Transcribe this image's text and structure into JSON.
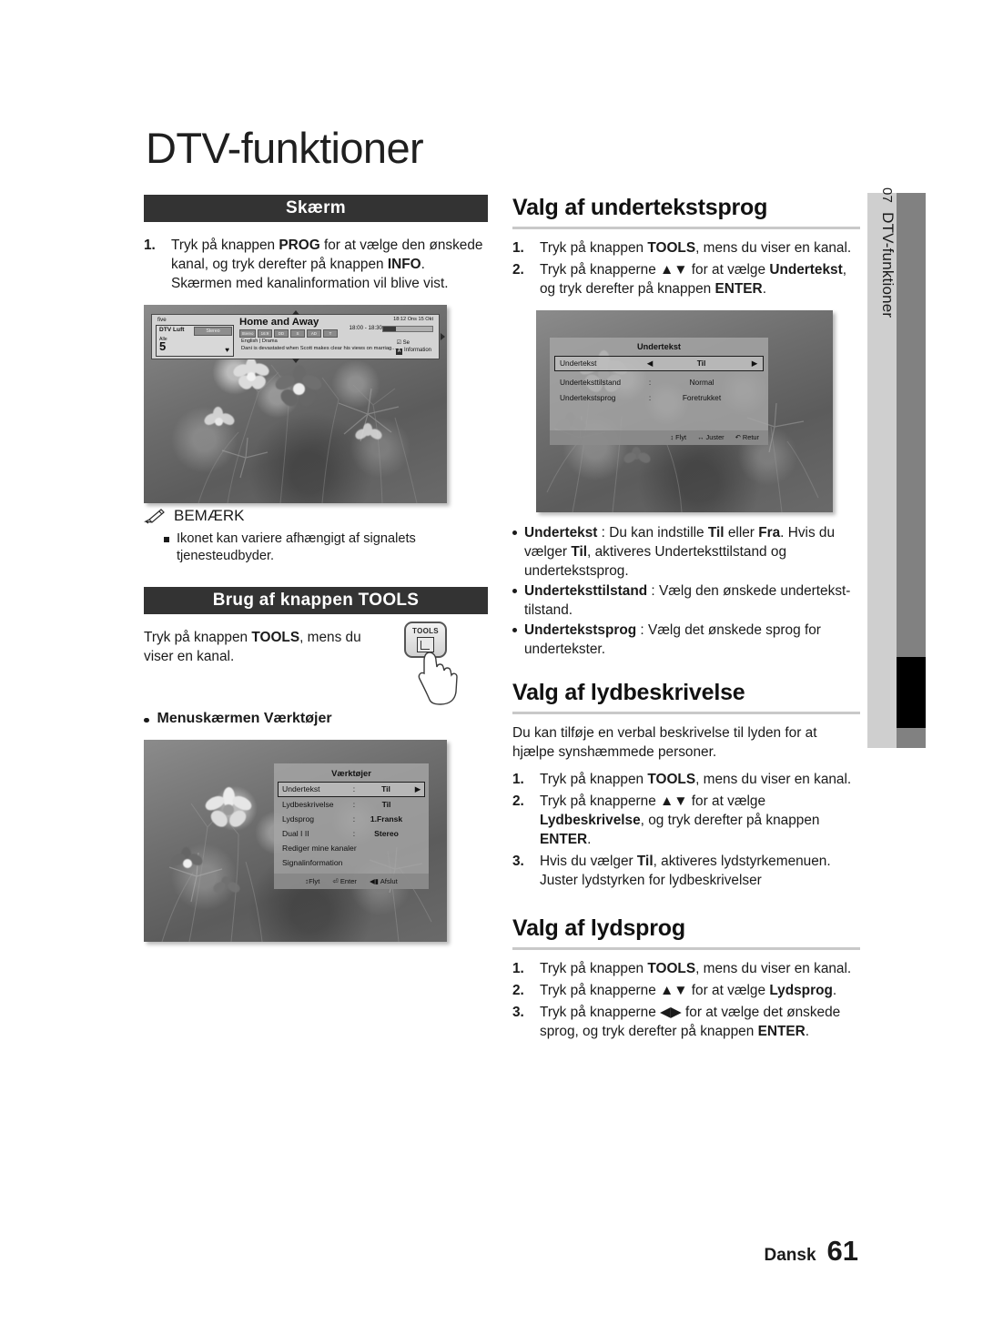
{
  "document": {
    "title": "DTV-funktioner",
    "footer": {
      "language": "Dansk",
      "page_number": "61"
    }
  },
  "sidebar": {
    "chapter_number": "07",
    "chapter_label": "DTV-funktioner"
  },
  "left_column": {
    "banner_skaerm": "Skærm",
    "steps": [
      {
        "num": "1.",
        "prefix": "Tryk på knappen ",
        "bold1": "PROG",
        "mid": " for at vælge den ønskede kanal, og tryk derefter på knappen ",
        "bold2": "INFO",
        "suffix": ". Skærmen med kanalinformation vil blive vist."
      }
    ],
    "note": {
      "heading": "BEMÆRK",
      "items": [
        "Ikonet kan variere afhængigt af signalets tjenesteudbyder."
      ]
    },
    "banner_tools": "Brug af knappen TOOLS",
    "tools_text": {
      "prefix": "Tryk på knappen ",
      "bold": "TOOLS",
      "suffix": ", mens du viser en kanal."
    },
    "tools_key_label": "TOOLS",
    "menu_bullet": "Menuskærmen Værktøjer"
  },
  "screen_info_banner": {
    "channel_brand": "five",
    "source": "DTV Luft",
    "audio": "Stereo",
    "list_label": "Alle",
    "channel_number": "5",
    "program_title": "Home and Away",
    "chips": [
      "Stereo",
      "16:9",
      "DD",
      "S",
      "AD",
      "T"
    ],
    "genre": "English  |  Drama",
    "description": "Dani is devastated when Scott makes clear his views on marriag...",
    "clock": "18:12 Ons 15 Okt",
    "timespan": "18:00 - 18:30",
    "action_watch": "Se",
    "action_info": "Information",
    "info_key": "A",
    "progress_percent": 26
  },
  "screen_vaerktojer": {
    "title": "Værktøjer",
    "rows": [
      {
        "label": "Undertekst",
        "sep": ":",
        "value": "Til",
        "selected": true,
        "arrow": true
      },
      {
        "label": "Lydbeskrivelse",
        "sep": ":",
        "value": "Til",
        "selected": false,
        "arrow": false
      },
      {
        "label": "Lydsprog",
        "sep": ":",
        "value": "1.Fransk",
        "selected": false,
        "arrow": false
      },
      {
        "label": "Dual I II",
        "sep": ":",
        "value": "Stereo",
        "selected": false,
        "arrow": false
      },
      {
        "label": "Rediger mine kanaler",
        "sep": "",
        "value": "",
        "selected": false,
        "arrow": false
      },
      {
        "label": "Signalinformation",
        "sep": "",
        "value": "",
        "selected": false,
        "arrow": false
      }
    ],
    "footer": [
      {
        "icon": "updown-arrows-icon",
        "label": "Flyt"
      },
      {
        "icon": "enter-icon",
        "label": "Enter"
      },
      {
        "icon": "exit-icon",
        "label": "Afslut"
      }
    ]
  },
  "screen_undertekst": {
    "title": "Undertekst",
    "rows": [
      {
        "label": "Undertekst",
        "sep": "",
        "value": "Til",
        "selected": true,
        "arrows": true
      },
      {
        "label": "Underteksttilstand",
        "sep": ":",
        "value": "Normal",
        "selected": false,
        "arrows": false
      },
      {
        "label": "Undertekstsprog",
        "sep": ":",
        "value": "Foretrukket",
        "selected": false,
        "arrows": false
      }
    ],
    "footer": [
      {
        "icon": "updown-arrows-icon",
        "label": "Flyt"
      },
      {
        "icon": "leftright-arrows-icon",
        "label": "Juster"
      },
      {
        "icon": "return-icon",
        "label": "Retur"
      }
    ]
  },
  "right_column": {
    "sections": [
      {
        "heading": "Valg af undertekstsprog",
        "steps": [
          {
            "num": "1.",
            "parts": [
              {
                "t": "Tryk på knappen ",
                "b": false
              },
              {
                "t": "TOOLS",
                "b": true
              },
              {
                "t": ", mens du viser en kanal.",
                "b": false
              }
            ]
          },
          {
            "num": "2.",
            "parts": [
              {
                "t": "Tryk på knapperne ▲▼ for at vælge ",
                "b": false
              },
              {
                "t": "Undertekst",
                "b": true
              },
              {
                "t": ", og tryk derefter på knappen ",
                "b": false
              },
              {
                "t": "ENTER",
                "b": true
              },
              {
                "t": ".",
                "b": false
              }
            ]
          }
        ],
        "bullets": [
          {
            "parts": [
              {
                "t": "Undertekst",
                "b": true
              },
              {
                "t": " : Du kan indstille ",
                "b": false
              },
              {
                "t": "Til",
                "b": true
              },
              {
                "t": " eller ",
                "b": false
              },
              {
                "t": "Fra",
                "b": true
              },
              {
                "t": ". Hvis du vælger ",
                "b": false
              },
              {
                "t": "Til",
                "b": true
              },
              {
                "t": ", aktiveres Underteksttilstand og undertekstsprog.",
                "b": false
              }
            ]
          },
          {
            "parts": [
              {
                "t": "Underteksttilstand",
                "b": true
              },
              {
                "t": " : Vælg den ønskede undertekst-tilstand.",
                "b": false
              }
            ]
          },
          {
            "parts": [
              {
                "t": "Undertekstsprog",
                "b": true
              },
              {
                "t": " : Vælg det ønskede sprog for undertekster.",
                "b": false
              }
            ]
          }
        ]
      },
      {
        "heading": "Valg af lydbeskrivelse",
        "intro": "Du kan tilføje en verbal beskrivelse til lyden for at hjælpe synshæmmede personer.",
        "steps": [
          {
            "num": "1.",
            "parts": [
              {
                "t": "Tryk på knappen ",
                "b": false
              },
              {
                "t": "TOOLS",
                "b": true
              },
              {
                "t": ", mens du viser en kanal.",
                "b": false
              }
            ]
          },
          {
            "num": "2.",
            "parts": [
              {
                "t": "Tryk på knapperne ▲▼ for at vælge ",
                "b": false
              },
              {
                "t": "Lydbeskrivelse",
                "b": true
              },
              {
                "t": ", og tryk derefter på knappen ",
                "b": false
              },
              {
                "t": "ENTER",
                "b": true
              },
              {
                "t": ".",
                "b": false
              }
            ]
          },
          {
            "num": "3.",
            "parts": [
              {
                "t": "Hvis du vælger ",
                "b": false
              },
              {
                "t": "Til",
                "b": true
              },
              {
                "t": ", aktiveres lydstyrkemenuen. Juster lydstyrken for lydbeskrivelser",
                "b": false
              }
            ]
          }
        ]
      },
      {
        "heading": "Valg af lydsprog",
        "steps": [
          {
            "num": "1.",
            "parts": [
              {
                "t": "Tryk på knappen ",
                "b": false
              },
              {
                "t": "TOOLS",
                "b": true
              },
              {
                "t": ", mens du viser en kanal.",
                "b": false
              }
            ]
          },
          {
            "num": "2.",
            "parts": [
              {
                "t": "Tryk på knapperne ▲▼ for at vælge ",
                "b": false
              },
              {
                "t": "Lydsprog",
                "b": true
              },
              {
                "t": ".",
                "b": false
              }
            ]
          },
          {
            "num": "3.",
            "parts": [
              {
                "t": "Tryk på knapperne ◀▶ for at vælge det ønskede sprog, og tryk derefter på knappen ",
                "b": false
              },
              {
                "t": "ENTER",
                "b": true
              },
              {
                "t": ".",
                "b": false
              }
            ]
          }
        ]
      }
    ]
  }
}
